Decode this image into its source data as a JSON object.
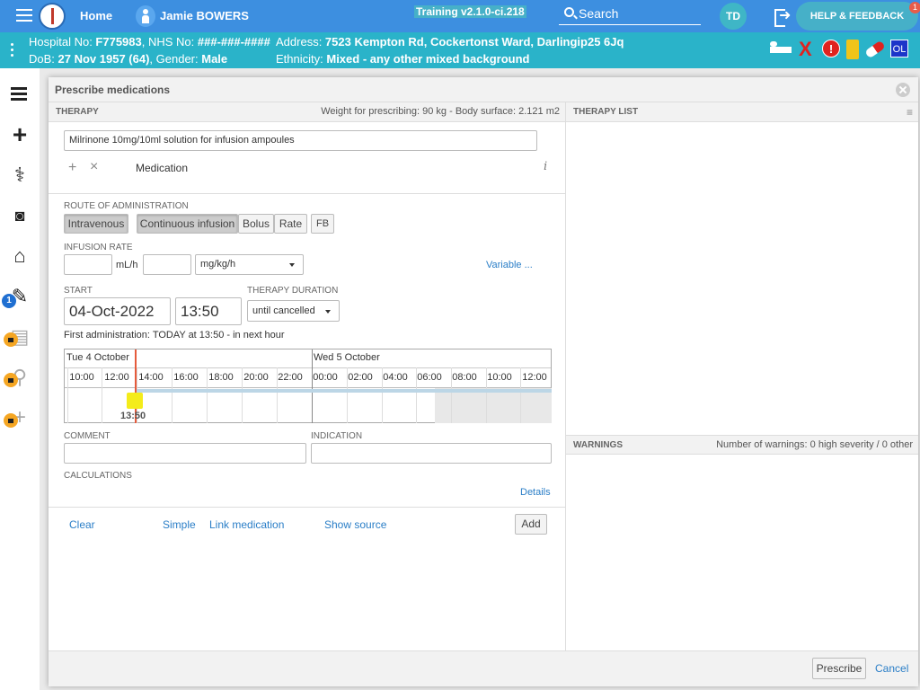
{
  "topbar": {
    "home_label": "Home",
    "patient_name": "Jamie BOWERS",
    "training_label": "Training v2.1.0-ci.218",
    "search_label": "Search",
    "avatar_initials": "TD",
    "help_label": "HELP & FEEDBACK",
    "help_badge": "1",
    "brand_color": "#3d8fe0"
  },
  "patient_bar": {
    "hospital_prefix": "Hospital No: ",
    "hospital_no": "F775983",
    "nhs_prefix": ", NHS No: ",
    "nhs_no": "###-###-####",
    "address_prefix": "Address: ",
    "address": "7523 Kempton Rd, Cockertonst Ward, Darlingip25 6Jq",
    "dob_prefix": "DoB: ",
    "dob": "27 Nov 1957 (64)",
    "gender_prefix": ", Gender: ",
    "gender": "Male",
    "ethnicity_prefix": "Ethnicity: ",
    "ethnicity": "Mixed - any other mixed background",
    "color": "#2ab3c9",
    "status_icons": [
      "bed-icon",
      "x-icon",
      "alert-icon",
      "bottle-icon",
      "pill-icon",
      "ol-icon"
    ],
    "alert_glyph": "!",
    "x_glyph": "X",
    "ol_label": "OL"
  },
  "sidebar": {
    "items": [
      "list-icon",
      "plus-icon",
      "stethoscope-icon",
      "camera-icon",
      "home-icon",
      "edit-icon",
      "clipboard-icon",
      "walking-icon",
      "add-icon"
    ],
    "badge_count": "1"
  },
  "modal": {
    "title": "Prescribe medications",
    "therapy": {
      "header": "THERAPY",
      "weight_info": "Weight for prescribing: 90 kg - Body surface: 2.121 m2",
      "medication_value": "Milrinone 10mg/10ml solution for infusion ampoules",
      "info_glyph": "i",
      "add_glyph": "+",
      "remove_glyph": "×",
      "medication_label": "Medication"
    },
    "route": {
      "label": "ROUTE OF ADMINISTRATION",
      "intravenous": "Intravenous",
      "continuous": "Continuous infusion",
      "bolus": "Bolus",
      "rate": "Rate",
      "fb": "FB"
    },
    "infusion": {
      "label": "INFUSION RATE",
      "unit1": "mL/h",
      "unit2": "mg/kg/h",
      "variable": "Variable ..."
    },
    "start": {
      "label": "START",
      "date": "04-Oct-2022",
      "time": "13:50",
      "duration_label": "THERAPY DURATION",
      "duration": "until cancelled",
      "first_admin": "First administration: TODAY at 13:50 - in next hour"
    },
    "timeline": {
      "day1": "Tue 4 October",
      "day2": "Wed 5 October",
      "hours": [
        "10:00",
        "12:00",
        "14:00",
        "16:00",
        "18:00",
        "20:00",
        "22:00",
        "00:00",
        "02:00",
        "04:00",
        "06:00",
        "08:00",
        "10:00",
        "12:00"
      ],
      "marker_time": "13:50"
    },
    "comment_label": "COMMENT",
    "indication_label": "INDICATION",
    "calculations_label": "CALCULATIONS",
    "details_link": "Details",
    "actions": {
      "clear": "Clear",
      "simple": "Simple",
      "link_medication": "Link medication",
      "show_source": "Show source",
      "add": "Add"
    },
    "therapy_list_header": "THERAPY LIST",
    "warnings_header": "WARNINGS",
    "warnings_summary": "Number of warnings: 0 high severity / 0 other",
    "footer": {
      "prescribe": "Prescribe",
      "cancel": "Cancel"
    }
  }
}
